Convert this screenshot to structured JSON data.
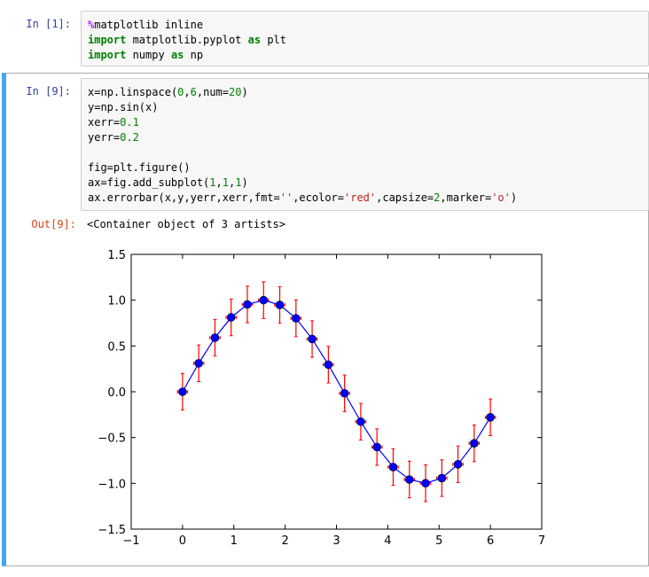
{
  "cells": {
    "cell1": {
      "prompt": "In  [1]:",
      "lines": [
        [
          {
            "t": "%",
            "c": "mg"
          },
          {
            "t": "matplotlib inline",
            "c": ""
          }
        ],
        [
          {
            "t": "import",
            "c": "kw"
          },
          {
            "t": " matplotlib.pyplot ",
            "c": ""
          },
          {
            "t": "as",
            "c": "kw"
          },
          {
            "t": " plt",
            "c": ""
          }
        ],
        [
          {
            "t": "import",
            "c": "kw"
          },
          {
            "t": " numpy ",
            "c": ""
          },
          {
            "t": "as",
            "c": "kw"
          },
          {
            "t": " np",
            "c": ""
          }
        ]
      ]
    },
    "cell2": {
      "prompt": "In  [9]:",
      "lines": [
        [
          {
            "t": "x",
            "c": ""
          },
          {
            "t": "=",
            "c": ""
          },
          {
            "t": "np.linspace(",
            "c": ""
          },
          {
            "t": "0",
            "c": "num"
          },
          {
            "t": ",",
            "c": ""
          },
          {
            "t": "6",
            "c": "num"
          },
          {
            "t": ",num=",
            "c": ""
          },
          {
            "t": "20",
            "c": "num"
          },
          {
            "t": ")",
            "c": ""
          }
        ],
        [
          {
            "t": "y=np.sin(x)",
            "c": ""
          }
        ],
        [
          {
            "t": "xerr=",
            "c": ""
          },
          {
            "t": "0.1",
            "c": "num"
          }
        ],
        [
          {
            "t": "yerr=",
            "c": ""
          },
          {
            "t": "0.2",
            "c": "num"
          }
        ],
        [],
        [
          {
            "t": "fig=plt.figure()",
            "c": ""
          }
        ],
        [
          {
            "t": "ax=fig.add_subplot(",
            "c": ""
          },
          {
            "t": "1",
            "c": "num"
          },
          {
            "t": ",",
            "c": ""
          },
          {
            "t": "1",
            "c": "num"
          },
          {
            "t": ",",
            "c": ""
          },
          {
            "t": "1",
            "c": "num"
          },
          {
            "t": ")",
            "c": ""
          }
        ],
        [
          {
            "t": "ax.errorbar(x,y,yerr,xerr,fmt=",
            "c": ""
          },
          {
            "t": "''",
            "c": "str"
          },
          {
            "t": ",ecolor=",
            "c": ""
          },
          {
            "t": "'red'",
            "c": "str"
          },
          {
            "t": ",capsize=",
            "c": ""
          },
          {
            "t": "2",
            "c": "num"
          },
          {
            "t": ",marker=",
            "c": ""
          },
          {
            "t": "'o'",
            "c": "str"
          },
          {
            "t": ")",
            "c": ""
          }
        ]
      ],
      "out_prompt": "Out[9]:",
      "out_text": "<Container object of 3 artists>"
    }
  },
  "colors": {
    "line": "#0000ff",
    "marker": "#0000ff",
    "ecolor": "#ff0000"
  },
  "chart_data": {
    "type": "scatter",
    "title": "",
    "xlabel": "",
    "ylabel": "",
    "xlim": [
      -1,
      7
    ],
    "ylim": [
      -1.5,
      1.5
    ],
    "xticks": [
      -1,
      0,
      1,
      2,
      3,
      4,
      5,
      6,
      7
    ],
    "yticks": [
      -1.5,
      -1.0,
      -0.5,
      0.0,
      0.5,
      1.0,
      1.5
    ],
    "xtick_labels": [
      "−1",
      "0",
      "1",
      "2",
      "3",
      "4",
      "5",
      "6",
      "7"
    ],
    "ytick_labels": [
      "−1.5",
      "−1.0",
      "−0.5",
      "0.0",
      "0.5",
      "1.0",
      "1.5"
    ],
    "grid": false,
    "series": [
      {
        "x": [
          0.0,
          0.316,
          0.632,
          0.947,
          1.263,
          1.579,
          1.895,
          2.211,
          2.526,
          2.842,
          3.158,
          3.474,
          3.789,
          4.105,
          4.421,
          4.737,
          5.053,
          5.368,
          5.684,
          6.0
        ],
        "y": [
          0.0,
          0.311,
          0.59,
          0.812,
          0.953,
          1.0,
          0.948,
          0.802,
          0.576,
          0.296,
          -0.017,
          -0.327,
          -0.604,
          -0.822,
          -0.958,
          -0.999,
          -0.943,
          -0.792,
          -0.563,
          -0.279
        ],
        "xerr": 0.1,
        "yerr": 0.2
      }
    ]
  }
}
